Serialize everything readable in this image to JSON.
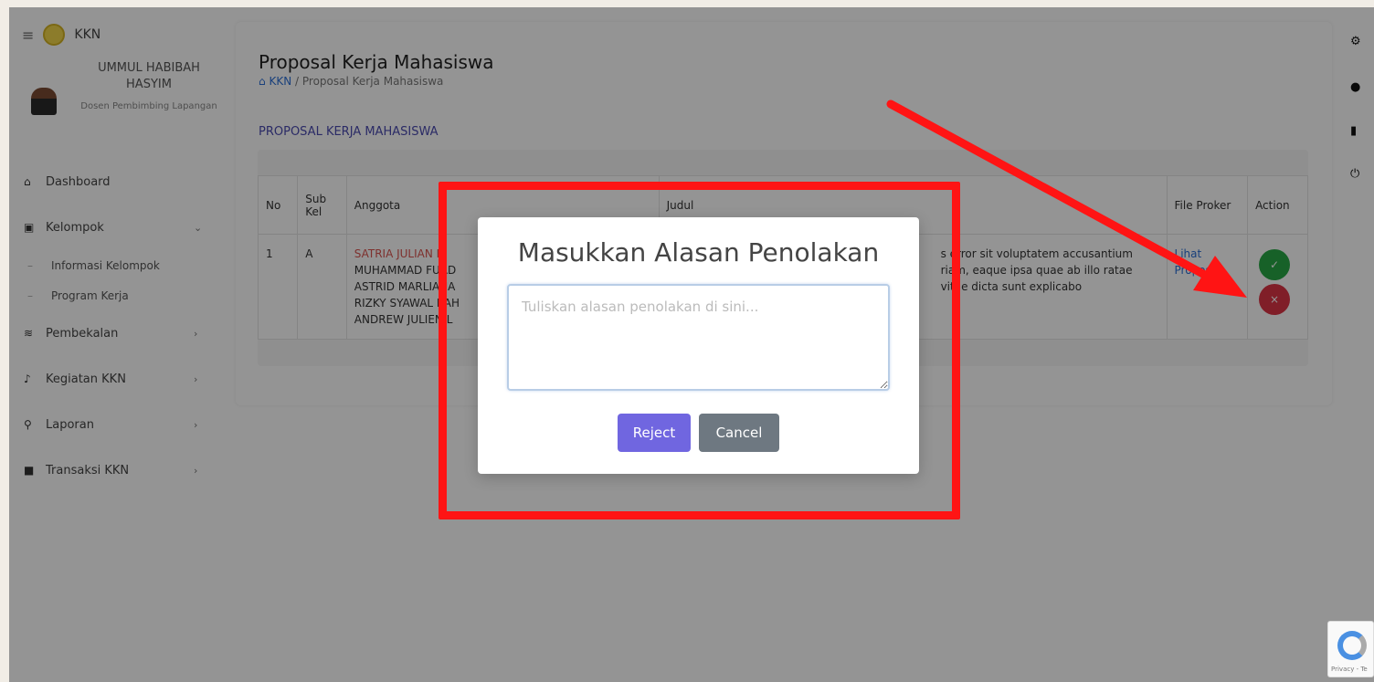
{
  "sidebar": {
    "brand": "KKN",
    "user_name": "UMMUL HABIBAH HASYIM",
    "user_role": "Dosen Pembimbing Lapangan",
    "menu": [
      {
        "label": "Dashboard",
        "icon": "home-icon"
      },
      {
        "label": "Kelompok",
        "icon": "group-icon",
        "chevron": "⌄"
      },
      {
        "label": "Pembekalan",
        "icon": "layers-icon",
        "chevron": "›"
      },
      {
        "label": "Kegiatan KKN",
        "icon": "activity-icon",
        "chevron": "›"
      },
      {
        "label": "Laporan",
        "icon": "search-report-icon",
        "chevron": "›"
      },
      {
        "label": "Transaksi KKN",
        "icon": "book-icon",
        "chevron": "›"
      }
    ],
    "submenu": [
      "Informasi Kelompok",
      "Program Kerja"
    ]
  },
  "page": {
    "title": "Proposal Kerja Mahasiswa",
    "breadcrumb_home": "KKN",
    "breadcrumb_sep": "/",
    "breadcrumb_current": "Proposal Kerja Mahasiswa",
    "section_title": "PROPOSAL KERJA MAHASISWA"
  },
  "table": {
    "headers": {
      "no": "No",
      "sub_kel": "Sub Kel",
      "anggota": "Anggota",
      "judul": "Judul",
      "file": "File Proker",
      "action": "Action"
    },
    "row": {
      "no": "1",
      "sub_kel": "A",
      "anggota_first": "SATRIA JULIAN E",
      "anggota_rest": [
        "MUHAMMAD FUAD",
        "ASTRID MARLIANA",
        "RIZKY SYAWAL RAH",
        "ANDREW JULIEN L"
      ],
      "judul": "s error sit voluptatem accusantium riam, eaque ipsa quae ab illo ratae vitae dicta sunt explicabo",
      "file_link": "Lihat Proposal"
    }
  },
  "modal": {
    "title": "Masukkan Alasan Penolakan",
    "textarea_placeholder": "Tuliskan alasan penolakan di sini...",
    "reject_label": "Reject",
    "cancel_label": "Cancel"
  },
  "recaptcha": {
    "text": "Privacy - Te"
  },
  "colors": {
    "accent": "#7066e0",
    "cancel": "#6e7881",
    "annotation": "#ff1414",
    "approve": "#28a745",
    "reject": "#dc3545"
  }
}
